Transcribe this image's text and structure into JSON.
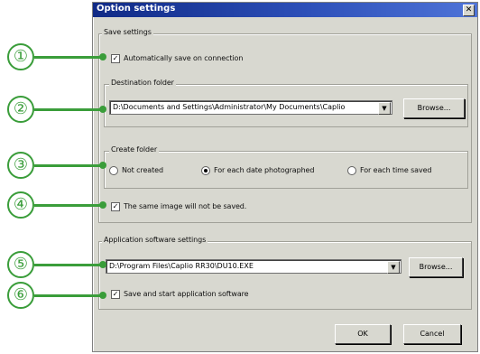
{
  "window": {
    "title": "Option settings",
    "close_glyph": "✕"
  },
  "save_settings": {
    "group_label": "Save settings",
    "auto_save": {
      "label": "Automatically save on connection",
      "checked": true
    },
    "destination": {
      "group_label": "Destination folder",
      "path": "D:\\Documents and Settings\\Administrator\\My Documents\\Caplio",
      "browse_label": "Browse..."
    },
    "create_folder": {
      "group_label": "Create folder",
      "options": [
        {
          "label": "Not created",
          "selected": false
        },
        {
          "label": "For each date photographed",
          "selected": true
        },
        {
          "label": "For each time saved",
          "selected": false
        }
      ]
    },
    "same_image": {
      "label": "The same image will not be saved.",
      "checked": true
    }
  },
  "application": {
    "group_label": "Application software settings",
    "path": "D:\\Program Files\\Caplio RR30\\DU10.EXE",
    "browse_label": "Browse...",
    "start_app": {
      "label": "Save and start application software",
      "checked": true
    }
  },
  "footer": {
    "ok_label": "OK",
    "cancel_label": "Cancel"
  },
  "callouts": [
    "①",
    "②",
    "③",
    "④",
    "⑤",
    "⑥"
  ],
  "glyphs": {
    "check": "✓",
    "dropdown": "▼"
  },
  "colors": {
    "callout_green": "#3a9d3a",
    "titlebar_blue": "#102a86",
    "dialog_bg": "#d8d8d0"
  }
}
